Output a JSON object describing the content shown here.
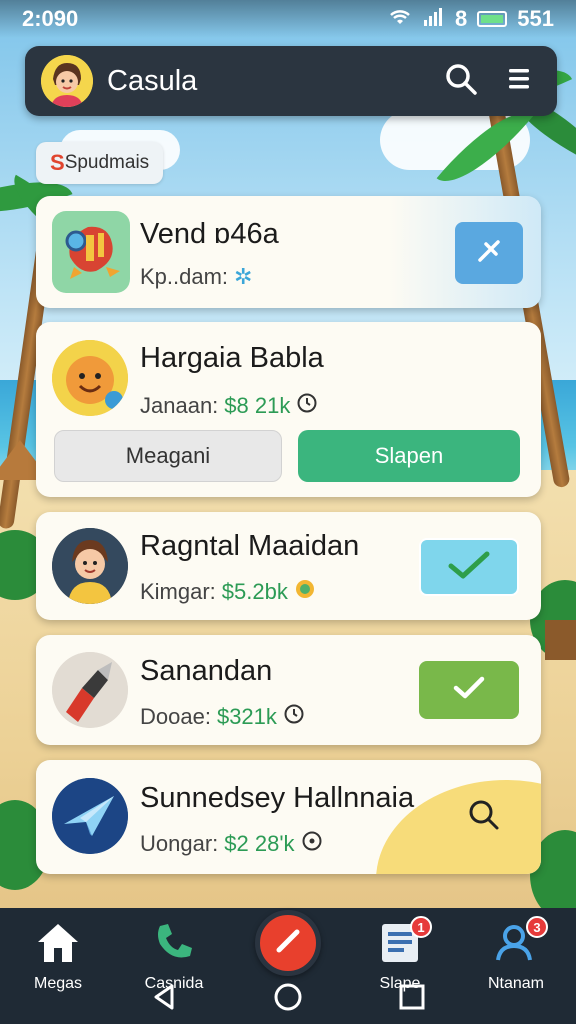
{
  "status_bar": {
    "time": "2:090",
    "right_text": "8",
    "battery_text": "551"
  },
  "app_bar": {
    "title": "Casula"
  },
  "section_chip": {
    "prefix": "S",
    "label": "Spudmais"
  },
  "cards": [
    {
      "title": "Vend ɒ46a",
      "subtitle_label": "Kp..dam:",
      "price": "",
      "action": "close-icon"
    },
    {
      "title": "Hargaia Babla",
      "subtitle_label": "Janaan:",
      "price": "$8 21k",
      "secondary_button": "Meagani",
      "primary_button": "Slapen"
    },
    {
      "title": "Ragntal Maaidan",
      "subtitle_label": "Kimgar:",
      "price": "$5.2bk",
      "action": "check-icon"
    },
    {
      "title": "Sanandan",
      "subtitle_label": "Dooae:",
      "price": "$321k",
      "action": "check-icon"
    },
    {
      "title": "Sunnedsey Hallnnaia",
      "subtitle_label": "Uongar:",
      "price": "$2 28'k",
      "action": "search-icon"
    }
  ],
  "bottom_nav": [
    {
      "label": "Megas",
      "icon": "home-icon"
    },
    {
      "label": "Casnida",
      "icon": "phone-icon"
    },
    {
      "label": "Slape",
      "icon": "document-icon",
      "badge": "1"
    },
    {
      "label": "Ntanam",
      "icon": "profile-icon",
      "badge": "3"
    }
  ],
  "colors": {
    "app_bar": "#2b3540",
    "primary_green": "#3bb57e",
    "action_check_light": "#7fd6ec",
    "action_check_green": "#79b84a",
    "action_close": "#5aa8e0",
    "fab": "#e8402d",
    "nav_bg": "#1f2a35"
  }
}
